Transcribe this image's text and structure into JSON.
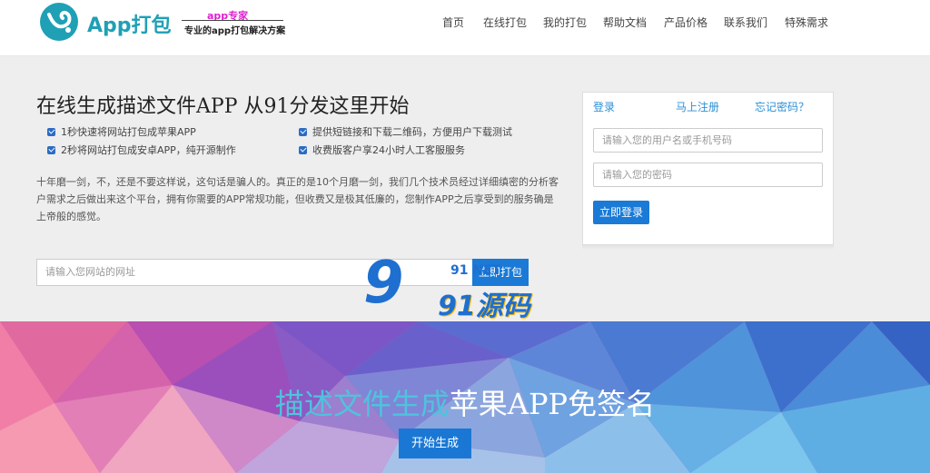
{
  "header": {
    "brand": "App打包",
    "tag_top": "app专家",
    "tag_sub": "专业的app打包解决方案",
    "nav": [
      "首页",
      "在线打包",
      "我的打包",
      "帮助文档",
      "产品价格",
      "联系我们",
      "特殊需求"
    ]
  },
  "main": {
    "headline": "在线生成描述文件APP  从91分发这里开始",
    "features": [
      "1秒快速将网站打包成苹果APP",
      "提供短链接和下载二维码，方便用户下载测试",
      "2秒将网站打包成安卓APP，纯开源制作",
      "收费版客户享24小时人工客服服务"
    ],
    "description": "十年磨一剑，不，还是不要这样说，这句话是骗人的。真正的是10个月磨一剑，我们几个技术员经过详细缜密的分析客户需求之后做出来这个平台，拥有你需要的APP常规功能，但收费又是极其低廉的，您制作APP之后享受到的服务确是上帝般的感觉。",
    "site_placeholder": "请输入您网站的网址",
    "pack_button": "立即打包"
  },
  "login": {
    "tabs": [
      "登录",
      "马上注册",
      "忘记密码？"
    ],
    "username_placeholder": "请输入您的用户名或手机号码",
    "password_placeholder": "请输入您的密码",
    "login_button": "立即登录"
  },
  "watermark": {
    "big": "9",
    "small": "91 NET",
    "text": "91源码"
  },
  "banner": {
    "title_highlight": "描述文件生成",
    "title_rest": "苹果APP免签名",
    "start_button": "开始生成"
  },
  "colors": {
    "accent": "#1a7ad6",
    "brand": "#1fa0b5",
    "tag": "#e01fd0"
  }
}
